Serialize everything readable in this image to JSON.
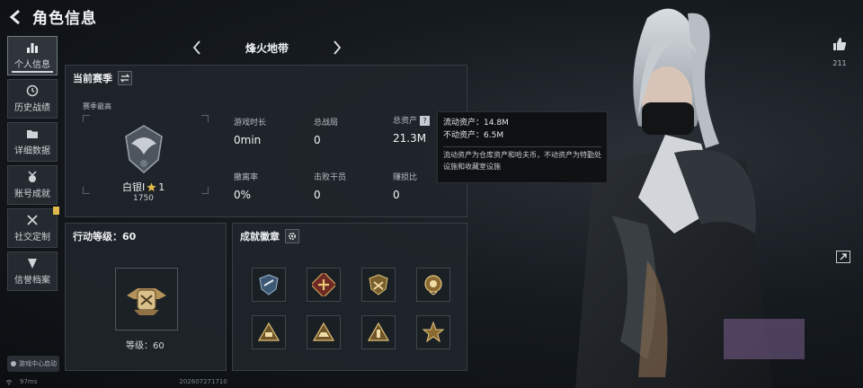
{
  "header": {
    "title": "角色信息"
  },
  "sidebar": {
    "items": [
      {
        "label": "个人信息",
        "icon": "bar-chart-icon"
      },
      {
        "label": "历史战绩",
        "icon": "history-icon"
      },
      {
        "label": "详细数据",
        "icon": "folder-icon"
      },
      {
        "label": "账号成就",
        "icon": "medal-icon"
      },
      {
        "label": "社交定制",
        "icon": "tools-icon"
      },
      {
        "label": "信誉档案",
        "icon": "shield-icon"
      }
    ],
    "game_center": "游戏中心启动"
  },
  "tab_nav": {
    "title": "烽火地带"
  },
  "season": {
    "title": "当前赛季",
    "subtitle": "赛季最高",
    "rank_name": "白银I",
    "rank_stars": "1",
    "rank_score": "1750",
    "stats": [
      {
        "key": "游戏时长",
        "value": "0min"
      },
      {
        "key": "总战局",
        "value": "0"
      },
      {
        "key": "总资产",
        "value": "21.3M"
      },
      {
        "key": "撤离率",
        "value": "0%"
      },
      {
        "key": "击败干员",
        "value": "0"
      },
      {
        "key": "赚损比",
        "value": "0"
      }
    ]
  },
  "tooltip": {
    "liquid": "流动资产：14.8M",
    "fixed": "不动资产：6.5M",
    "note": "流动资产为仓库资产和哈夫币，不动资产为特勤处设施和收藏室设施"
  },
  "action_level": {
    "title": "行动等级：60",
    "level_label": "等级：60"
  },
  "badges": {
    "title": "成就徽章"
  },
  "right": {
    "like_count": "211"
  },
  "bottom": {
    "ping": "97ms",
    "id": "202607271710"
  },
  "colors": {
    "accent_gold": "#e2b94b",
    "panel_bg": "#20252a"
  }
}
